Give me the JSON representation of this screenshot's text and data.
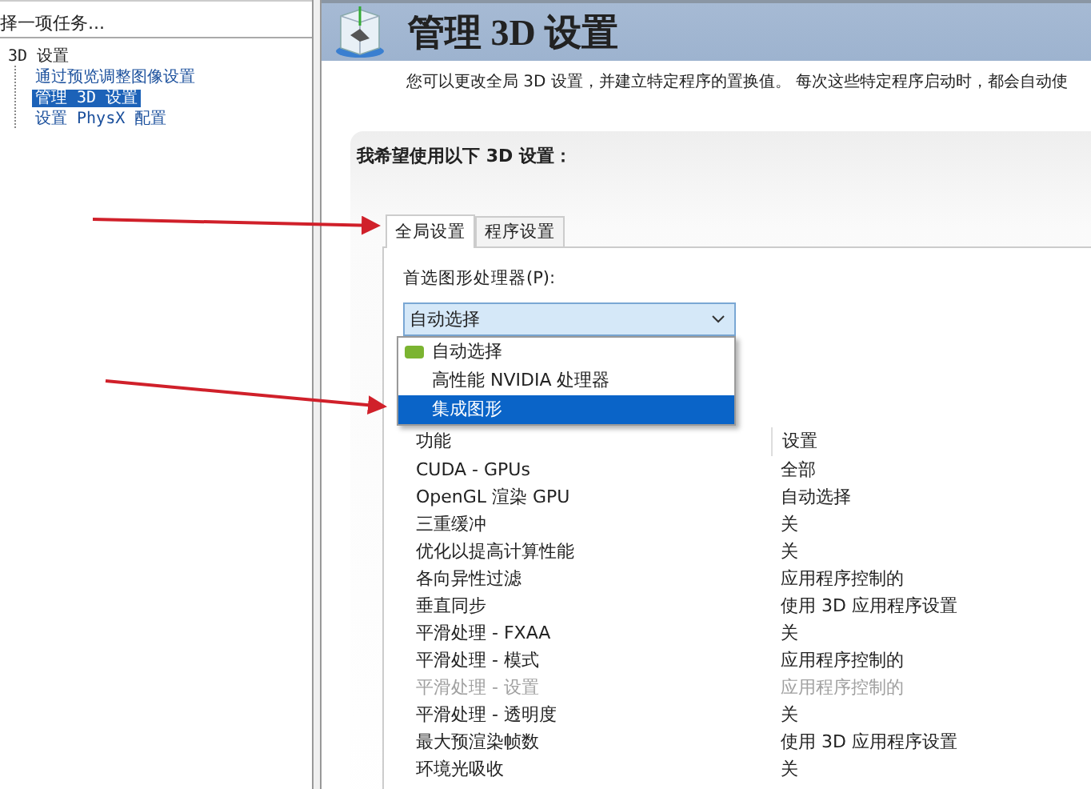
{
  "sidebar": {
    "heading": "择一项任务...",
    "tree": [
      {
        "label": "3D 设置",
        "selected": false,
        "children": [
          {
            "label": "通过预览调整图像设置",
            "selected": false
          },
          {
            "label": "管理 3D 设置",
            "selected": true
          },
          {
            "label": "设置 PhysX 配置",
            "selected": false
          }
        ]
      }
    ]
  },
  "page": {
    "title": "管理 3D 设置",
    "description": "您可以更改全局 3D 设置，并建立特定程序的置换值。 每次这些特定程序启动时，都会自动使"
  },
  "settings": {
    "heading": "我希望使用以下 3D 设置：",
    "tabs": [
      {
        "label": "全局设置",
        "selected": true
      },
      {
        "label": "程序设置",
        "selected": false
      }
    ],
    "processor_label": "首选图形处理器(P):",
    "processor": {
      "value": "自动选择",
      "expanded": true,
      "options": [
        {
          "label": "自动选择",
          "kind": "nvidia",
          "highlighted": false
        },
        {
          "label": "高性能 NVIDIA 处理器",
          "kind": "plain",
          "highlighted": false
        },
        {
          "label": "集成图形",
          "kind": "plain",
          "highlighted": true
        }
      ]
    },
    "table": {
      "columns": [
        "功能",
        "设置"
      ],
      "rows": [
        {
          "cells": [
            "CUDA - GPUs",
            "全部"
          ],
          "disabled": false
        },
        {
          "cells": [
            "OpenGL 渲染 GPU",
            "自动选择"
          ],
          "disabled": false
        },
        {
          "cells": [
            "三重缓冲",
            "关"
          ],
          "disabled": false
        },
        {
          "cells": [
            "优化以提高计算性能",
            "关"
          ],
          "disabled": false
        },
        {
          "cells": [
            "各向异性过滤",
            "应用程序控制的"
          ],
          "disabled": false
        },
        {
          "cells": [
            "垂直同步",
            "使用 3D 应用程序设置"
          ],
          "disabled": false
        },
        {
          "cells": [
            "平滑处理 - FXAA",
            "关"
          ],
          "disabled": false
        },
        {
          "cells": [
            "平滑处理 - 模式",
            "应用程序控制的"
          ],
          "disabled": false
        },
        {
          "cells": [
            "平滑处理 - 设置",
            "应用程序控制的"
          ],
          "disabled": true
        },
        {
          "cells": [
            "平滑处理 - 透明度",
            "关"
          ],
          "disabled": false
        },
        {
          "cells": [
            "最大预渲染帧数",
            "使用 3D 应用程序设置"
          ],
          "disabled": false
        },
        {
          "cells": [
            "环境光吸收",
            "关"
          ],
          "disabled": false
        }
      ]
    }
  }
}
